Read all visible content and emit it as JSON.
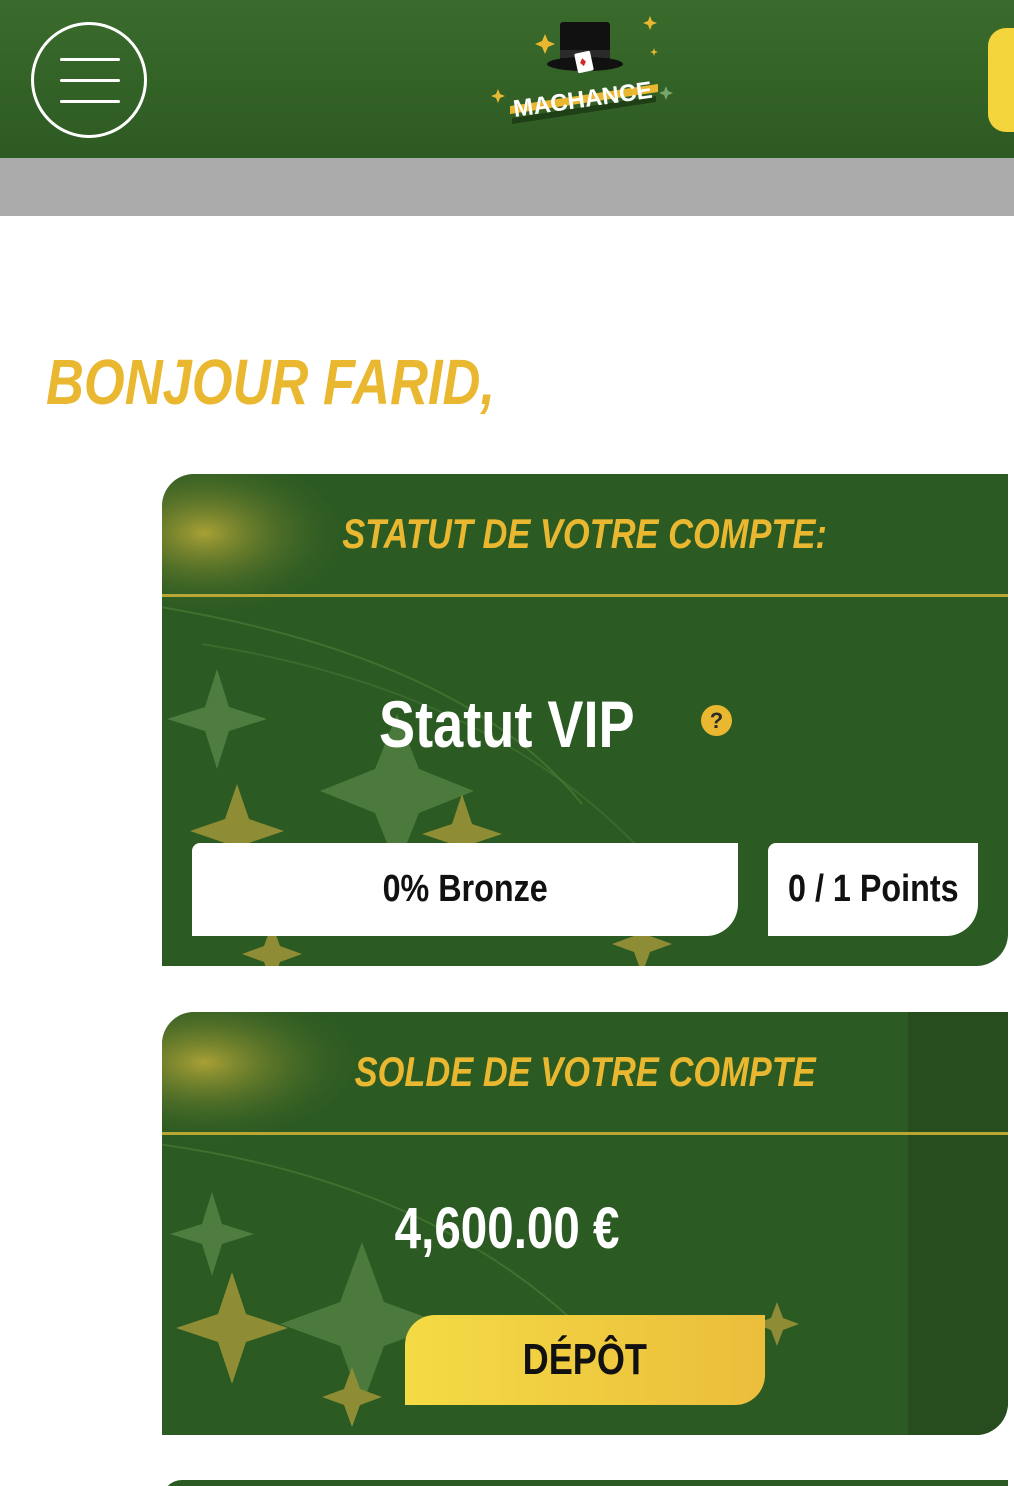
{
  "header": {
    "logo_text": "MACHANCE"
  },
  "greeting": "BONJOUR FARID,",
  "status_card": {
    "title": "STATUT DE VOTRE COMPTE:",
    "vip_label": "Statut VIP",
    "help_symbol": "?",
    "progress_text": "0% Bronze",
    "points_text": "0 / 1 Points"
  },
  "balance_card": {
    "title": "SOLDE DE VOTRE COMPTE",
    "amount": "4,600.00 €",
    "deposit_label": "DÉPÔT"
  },
  "colors": {
    "brand_green": "#2b5a22",
    "accent_gold": "#eab830",
    "button_yellow": "#f3d43a"
  }
}
